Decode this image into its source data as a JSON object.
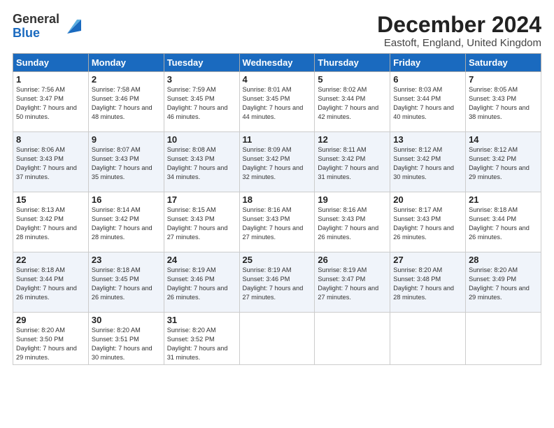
{
  "logo": {
    "general": "General",
    "blue": "Blue"
  },
  "title": "December 2024",
  "location": "Eastoft, England, United Kingdom",
  "days_of_week": [
    "Sunday",
    "Monday",
    "Tuesday",
    "Wednesday",
    "Thursday",
    "Friday",
    "Saturday"
  ],
  "weeks": [
    [
      {
        "day": "1",
        "sunrise": "Sunrise: 7:56 AM",
        "sunset": "Sunset: 3:47 PM",
        "daylight": "Daylight: 7 hours and 50 minutes."
      },
      {
        "day": "2",
        "sunrise": "Sunrise: 7:58 AM",
        "sunset": "Sunset: 3:46 PM",
        "daylight": "Daylight: 7 hours and 48 minutes."
      },
      {
        "day": "3",
        "sunrise": "Sunrise: 7:59 AM",
        "sunset": "Sunset: 3:45 PM",
        "daylight": "Daylight: 7 hours and 46 minutes."
      },
      {
        "day": "4",
        "sunrise": "Sunrise: 8:01 AM",
        "sunset": "Sunset: 3:45 PM",
        "daylight": "Daylight: 7 hours and 44 minutes."
      },
      {
        "day": "5",
        "sunrise": "Sunrise: 8:02 AM",
        "sunset": "Sunset: 3:44 PM",
        "daylight": "Daylight: 7 hours and 42 minutes."
      },
      {
        "day": "6",
        "sunrise": "Sunrise: 8:03 AM",
        "sunset": "Sunset: 3:44 PM",
        "daylight": "Daylight: 7 hours and 40 minutes."
      },
      {
        "day": "7",
        "sunrise": "Sunrise: 8:05 AM",
        "sunset": "Sunset: 3:43 PM",
        "daylight": "Daylight: 7 hours and 38 minutes."
      }
    ],
    [
      {
        "day": "8",
        "sunrise": "Sunrise: 8:06 AM",
        "sunset": "Sunset: 3:43 PM",
        "daylight": "Daylight: 7 hours and 37 minutes."
      },
      {
        "day": "9",
        "sunrise": "Sunrise: 8:07 AM",
        "sunset": "Sunset: 3:43 PM",
        "daylight": "Daylight: 7 hours and 35 minutes."
      },
      {
        "day": "10",
        "sunrise": "Sunrise: 8:08 AM",
        "sunset": "Sunset: 3:43 PM",
        "daylight": "Daylight: 7 hours and 34 minutes."
      },
      {
        "day": "11",
        "sunrise": "Sunrise: 8:09 AM",
        "sunset": "Sunset: 3:42 PM",
        "daylight": "Daylight: 7 hours and 32 minutes."
      },
      {
        "day": "12",
        "sunrise": "Sunrise: 8:11 AM",
        "sunset": "Sunset: 3:42 PM",
        "daylight": "Daylight: 7 hours and 31 minutes."
      },
      {
        "day": "13",
        "sunrise": "Sunrise: 8:12 AM",
        "sunset": "Sunset: 3:42 PM",
        "daylight": "Daylight: 7 hours and 30 minutes."
      },
      {
        "day": "14",
        "sunrise": "Sunrise: 8:12 AM",
        "sunset": "Sunset: 3:42 PM",
        "daylight": "Daylight: 7 hours and 29 minutes."
      }
    ],
    [
      {
        "day": "15",
        "sunrise": "Sunrise: 8:13 AM",
        "sunset": "Sunset: 3:42 PM",
        "daylight": "Daylight: 7 hours and 28 minutes."
      },
      {
        "day": "16",
        "sunrise": "Sunrise: 8:14 AM",
        "sunset": "Sunset: 3:42 PM",
        "daylight": "Daylight: 7 hours and 28 minutes."
      },
      {
        "day": "17",
        "sunrise": "Sunrise: 8:15 AM",
        "sunset": "Sunset: 3:43 PM",
        "daylight": "Daylight: 7 hours and 27 minutes."
      },
      {
        "day": "18",
        "sunrise": "Sunrise: 8:16 AM",
        "sunset": "Sunset: 3:43 PM",
        "daylight": "Daylight: 7 hours and 27 minutes."
      },
      {
        "day": "19",
        "sunrise": "Sunrise: 8:16 AM",
        "sunset": "Sunset: 3:43 PM",
        "daylight": "Daylight: 7 hours and 26 minutes."
      },
      {
        "day": "20",
        "sunrise": "Sunrise: 8:17 AM",
        "sunset": "Sunset: 3:43 PM",
        "daylight": "Daylight: 7 hours and 26 minutes."
      },
      {
        "day": "21",
        "sunrise": "Sunrise: 8:18 AM",
        "sunset": "Sunset: 3:44 PM",
        "daylight": "Daylight: 7 hours and 26 minutes."
      }
    ],
    [
      {
        "day": "22",
        "sunrise": "Sunrise: 8:18 AM",
        "sunset": "Sunset: 3:44 PM",
        "daylight": "Daylight: 7 hours and 26 minutes."
      },
      {
        "day": "23",
        "sunrise": "Sunrise: 8:18 AM",
        "sunset": "Sunset: 3:45 PM",
        "daylight": "Daylight: 7 hours and 26 minutes."
      },
      {
        "day": "24",
        "sunrise": "Sunrise: 8:19 AM",
        "sunset": "Sunset: 3:46 PM",
        "daylight": "Daylight: 7 hours and 26 minutes."
      },
      {
        "day": "25",
        "sunrise": "Sunrise: 8:19 AM",
        "sunset": "Sunset: 3:46 PM",
        "daylight": "Daylight: 7 hours and 27 minutes."
      },
      {
        "day": "26",
        "sunrise": "Sunrise: 8:19 AM",
        "sunset": "Sunset: 3:47 PM",
        "daylight": "Daylight: 7 hours and 27 minutes."
      },
      {
        "day": "27",
        "sunrise": "Sunrise: 8:20 AM",
        "sunset": "Sunset: 3:48 PM",
        "daylight": "Daylight: 7 hours and 28 minutes."
      },
      {
        "day": "28",
        "sunrise": "Sunrise: 8:20 AM",
        "sunset": "Sunset: 3:49 PM",
        "daylight": "Daylight: 7 hours and 29 minutes."
      }
    ],
    [
      {
        "day": "29",
        "sunrise": "Sunrise: 8:20 AM",
        "sunset": "Sunset: 3:50 PM",
        "daylight": "Daylight: 7 hours and 29 minutes."
      },
      {
        "day": "30",
        "sunrise": "Sunrise: 8:20 AM",
        "sunset": "Sunset: 3:51 PM",
        "daylight": "Daylight: 7 hours and 30 minutes."
      },
      {
        "day": "31",
        "sunrise": "Sunrise: 8:20 AM",
        "sunset": "Sunset: 3:52 PM",
        "daylight": "Daylight: 7 hours and 31 minutes."
      },
      null,
      null,
      null,
      null
    ]
  ]
}
